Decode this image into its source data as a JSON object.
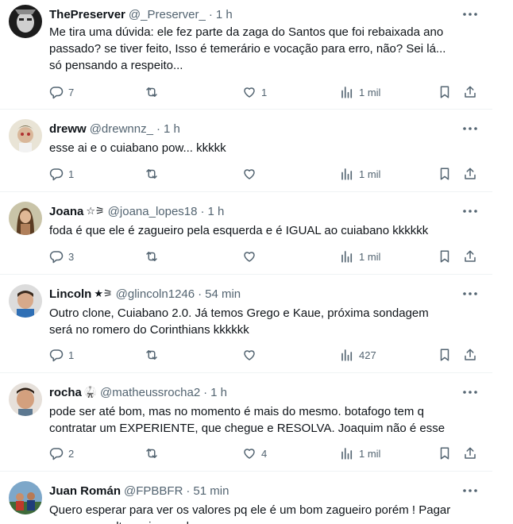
{
  "colors": {
    "text": "#0f1419",
    "secondary": "#536471",
    "divider": "#eff3f4"
  },
  "icons": {
    "more": "more-horizontal-icon",
    "reply": "reply-icon",
    "retweet": "retweet-icon",
    "like": "heart-icon",
    "views": "views-icon",
    "bookmark": "bookmark-icon",
    "share": "share-icon"
  },
  "tweets": [
    {
      "name": "ThePreserver",
      "badge": "",
      "handle": "@_Preserver_",
      "time": "1 h",
      "text": "Me tira uma dúvida: ele fez parte da zaga do Santos que foi rebaixada ano\npassado? se tiver feito, Isso é temerário e vocação para erro, não? Sei lá...\nsó pensando a respeito...",
      "replies": "7",
      "retweets": "",
      "likes": "1",
      "views": "1 mil"
    },
    {
      "name": "dreww",
      "badge": "",
      "handle": "@drewnnz_",
      "time": "1 h",
      "text": "esse ai e o cuiabano pow... kkkkk",
      "replies": "1",
      "retweets": "",
      "likes": "",
      "views": "1 mil"
    },
    {
      "name": "Joana",
      "badge": "☆⚞",
      "handle": "@joana_lopes18",
      "time": "1 h",
      "text": "foda é que ele é zagueiro pela esquerda e é IGUAL ao cuiabano kkkkkk",
      "replies": "3",
      "retweets": "",
      "likes": "",
      "views": "1 mil"
    },
    {
      "name": "Lincoln",
      "badge": "★⚞",
      "handle": "@glincoln1246",
      "time": "54 min",
      "text": "Outro clone,  Cuiabano 2.0. Já temos Grego e Kaue, próxima sondagem\nserá no romero do Corinthians kkkkkk",
      "replies": "1",
      "retweets": "",
      "likes": "",
      "views": "427"
    },
    {
      "name": "rocha",
      "badge": "🥋",
      "handle": "@matheussrocha2",
      "time": "1 h",
      "text": "pode ser até bom, mas no momento é mais do mesmo. botafogo tem q\ncontratar um EXPERIENTE, que chegue e RESOLVA. Joaquim não é esse",
      "replies": "2",
      "retweets": "",
      "likes": "4",
      "views": "1 mil"
    },
    {
      "name": "Juan Román",
      "badge": "",
      "handle": "@FPBBFR",
      "time": "51 min",
      "text": "Quero esperar para ver os valores pq ele é um bom zagueiro porém ! Pagar\numa grana alta seria errado",
      "replies": "",
      "retweets": "",
      "likes": "",
      "views": ""
    }
  ]
}
